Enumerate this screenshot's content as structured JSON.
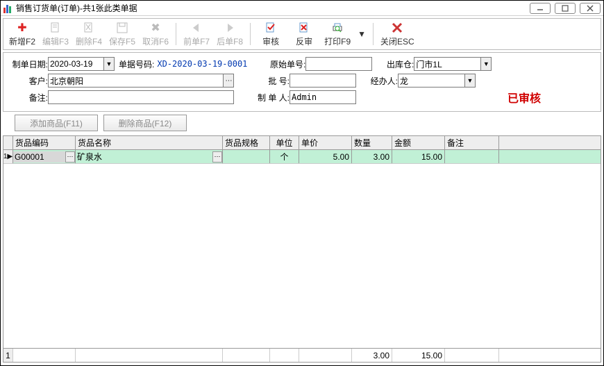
{
  "titlebar": {
    "title": "销售订货单(订单)-共1张此类单据"
  },
  "toolbar": {
    "new": "新增F2",
    "edit": "编辑F3",
    "delete": "删除F4",
    "save": "保存F5",
    "cancel": "取消F6",
    "prev": "前单F7",
    "next": "后单F8",
    "audit": "审核",
    "unaudit": "反审",
    "print": "打印F9",
    "close": "关闭ESC"
  },
  "form": {
    "date_label": "制单日期:",
    "date_value": "2020-03-19",
    "docno_label": "单据号码:",
    "docno_value": "XD-2020-03-19-0001",
    "origno_label": "原始单号:",
    "origno_value": "",
    "warehouse_label": "出库仓:",
    "warehouse_value": "门市1L",
    "customer_label": "客户:",
    "customer_value": "北京朝阳",
    "batch_label": "批    号:",
    "batch_value": "",
    "handler_label": "经办人:",
    "handler_value": "龙",
    "remark_label": "备注:",
    "remark_value": "",
    "maker_label": "制 单 人:",
    "maker_value": "Admin",
    "status": "已审核"
  },
  "buttons": {
    "add_item": "添加商品(F11)",
    "del_item": "删除商品(F12)"
  },
  "grid": {
    "headers": {
      "code": "货品编码",
      "name": "货品名称",
      "spec": "货品规格",
      "unit": "单位",
      "price": "单价",
      "qty": "数量",
      "amt": "金额",
      "note": "备注"
    },
    "rows": [
      {
        "indicator": "1▶",
        "code": "G00001",
        "name": "矿泉水",
        "spec": "",
        "unit": "个",
        "price": "5.00",
        "qty": "3.00",
        "amt": "15.00",
        "note": ""
      }
    ],
    "footer": {
      "indicator": "1",
      "qty": "3.00",
      "amt": "15.00"
    }
  }
}
